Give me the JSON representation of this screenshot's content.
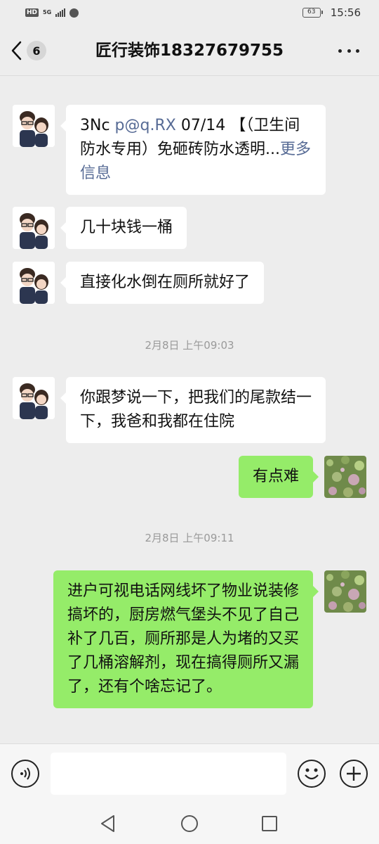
{
  "status_bar": {
    "hd": "HD",
    "network": "5G",
    "battery": "63",
    "time": "15:56"
  },
  "header": {
    "unread_count": "6",
    "title": "匠行装饰18327679755"
  },
  "chat": {
    "messages": [
      {
        "side": "left",
        "text": "3Nc ",
        "link1": "p@q.RX",
        "text2": " 07/14 【（卫生间防水专用）免砸砖防水透明...",
        "link2": "更多信息"
      },
      {
        "side": "left",
        "text": "几十块钱一桶"
      },
      {
        "side": "left",
        "text": "直接化水倒在厕所就好了"
      },
      {
        "side": "left",
        "text": "你跟梦说一下，把我们的尾款结一下，我爸和我都在住院"
      },
      {
        "side": "right",
        "text": "有点难"
      },
      {
        "side": "right",
        "text": "进户可视电话网线坏了物业说装修搞坏的，厨房燃气堡头不见了自己补了几百，厕所那是人为堵的又买了几桶溶解剂，现在搞得厕所又漏了，还有个啥忘记了。"
      }
    ],
    "timestamps": [
      "2月8日 上午09:03",
      "2月8日 上午09:11"
    ]
  },
  "colors": {
    "background": "#ededed",
    "sent_bubble": "#95ec69",
    "received_bubble": "#ffffff",
    "link": "#576b95"
  },
  "icons": [
    "back-chevron-icon",
    "more-dots-icon",
    "voice-icon",
    "emoji-icon",
    "plus-icon",
    "nav-back-icon",
    "nav-home-icon",
    "nav-recent-icon"
  ]
}
